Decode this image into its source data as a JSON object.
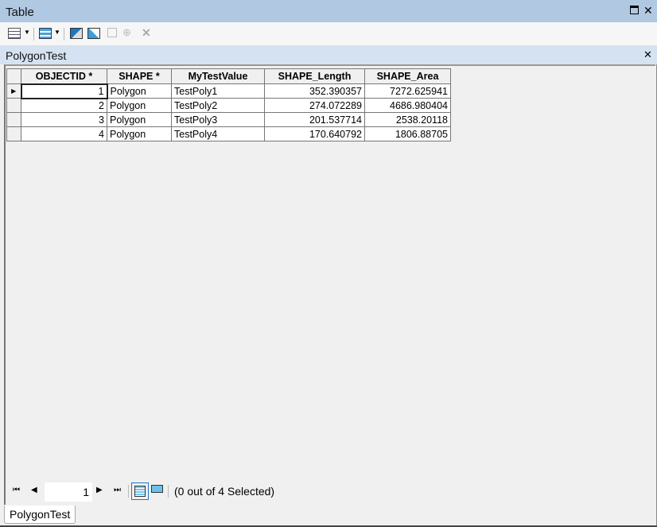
{
  "window": {
    "title": "Table"
  },
  "tab": {
    "title": "PolygonTest"
  },
  "table": {
    "columns": [
      "OBJECTID *",
      "SHAPE *",
      "MyTestValue",
      "SHAPE_Length",
      "SHAPE_Area"
    ],
    "rows": [
      [
        "1",
        "Polygon",
        "TestPoly1",
        "352.390357",
        "7272.625941"
      ],
      [
        "2",
        "Polygon",
        "TestPoly2",
        "274.072289",
        "4686.980404"
      ],
      [
        "3",
        "Polygon",
        "TestPoly3",
        "201.537714",
        "2538.20118"
      ],
      [
        "4",
        "Polygon",
        "TestPoly4",
        "170.640792",
        "1806.88705"
      ]
    ]
  },
  "nav": {
    "page": "1",
    "status": "(0 out of 4 Selected)"
  },
  "bottom_tab": "PolygonTest"
}
